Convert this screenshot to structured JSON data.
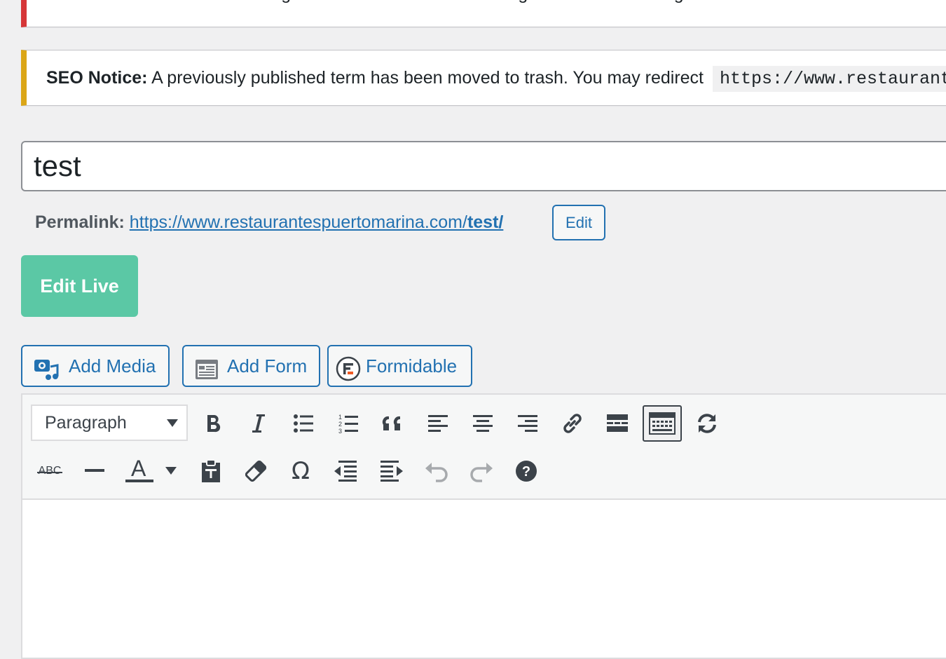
{
  "notices": {
    "error_text": "Please activate WPML Multilingual CMS to have WPML String Translation working.",
    "seo_label": "SEO Notice:",
    "seo_text": "A previously published term has been moved to trash. You may redirect",
    "seo_code": "https://www.restaurantespuertomarina.com/test/"
  },
  "post": {
    "title": "test",
    "permalink_label": "Permalink:",
    "permalink_base": "https://www.restaurantespuertomarina.com/",
    "permalink_slug": "test/",
    "edit_label": "Edit",
    "edit_live_label": "Edit Live"
  },
  "media_buttons": {
    "add_media": "Add Media",
    "add_form": "Add Form",
    "formidable": "Formidable"
  },
  "editor": {
    "format_value": "Paragraph",
    "abc_label": "ABC",
    "text_color_letter": "A"
  },
  "colors": {
    "accent": "#2271b1",
    "edit_live_bg": "#5bc8a5",
    "error_border": "#d63638",
    "warning_border": "#dba617"
  }
}
